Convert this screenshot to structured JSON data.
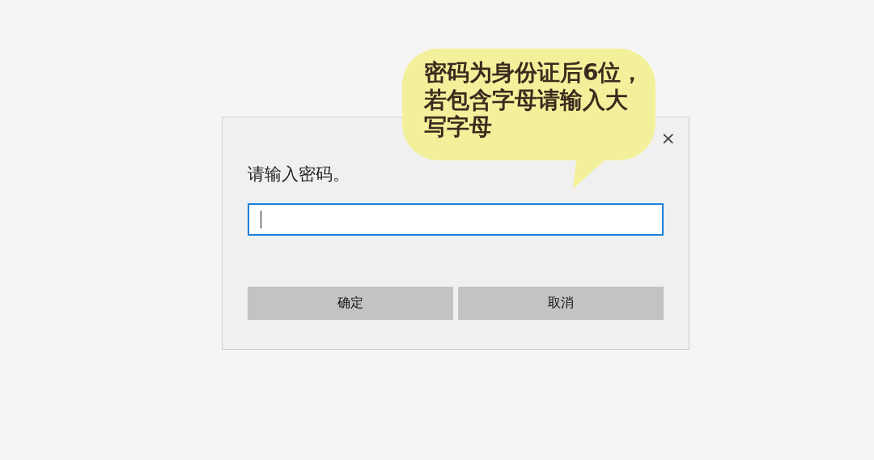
{
  "dialog": {
    "close": "×",
    "prompt": "请输入密码。",
    "password_field": {
      "focused": true
    },
    "buttons": [
      {
        "label": "确定"
      },
      {
        "label": "取消"
      }
    ]
  },
  "callout": {
    "text": "密码为身份证后6位，若包含字母请输入大写字母"
  }
}
